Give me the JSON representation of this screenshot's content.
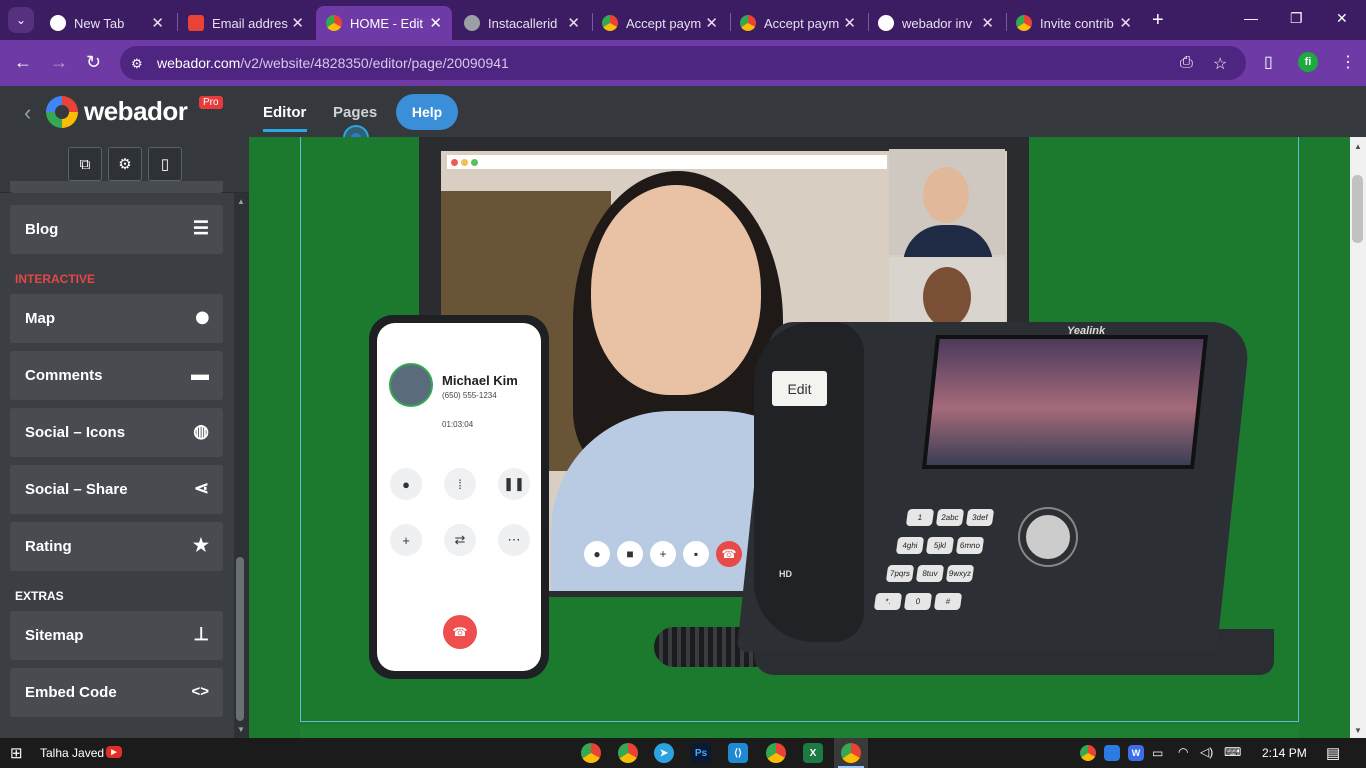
{
  "browser": {
    "tabs": [
      {
        "label": "New Tab",
        "favicon_color": "#ffffff"
      },
      {
        "label": "Email addres",
        "favicon_color": "#ea4335"
      },
      {
        "label": "HOME - Edit",
        "favicon_color": "#fbbc05",
        "active": true
      },
      {
        "label": "Instacallerid",
        "favicon_color": "#9aa0a6"
      },
      {
        "label": "Accept paym",
        "favicon_color": "#fbbc05"
      },
      {
        "label": "Accept paym",
        "favicon_color": "#fbbc05"
      },
      {
        "label": "webador inv",
        "favicon_color": "#ffffff"
      },
      {
        "label": "Invite contrib",
        "favicon_color": "#fbbc05"
      }
    ],
    "tab_close": "✕",
    "new_tab": "+",
    "url_host": "webador.com",
    "url_path": "/v2/website/4828350/editor/page/20090941",
    "extension_label": "fi"
  },
  "editor": {
    "logo_text": "webador",
    "pro_badge": "Pro",
    "tabs": {
      "editor": "Editor",
      "pages": "Pages"
    },
    "help_label": "Help"
  },
  "sidebar": {
    "items_top": [
      {
        "label": "Blog",
        "icon": "document-icon",
        "glyph": "☰"
      }
    ],
    "section_interactive": "INTERACTIVE",
    "interactive_items": [
      {
        "label": "Map",
        "icon": "map-pin-icon",
        "glyph": "⬤"
      },
      {
        "label": "Comments",
        "icon": "comment-icon",
        "glyph": "▬"
      },
      {
        "label": "Social – Icons",
        "icon": "globe-icon",
        "glyph": "◍"
      },
      {
        "label": "Social – Share",
        "icon": "share-icon",
        "glyph": "⋖"
      },
      {
        "label": "Rating",
        "icon": "star-icon",
        "glyph": "★"
      }
    ],
    "section_extras": "EXTRAS",
    "extras_items": [
      {
        "label": "Sitemap",
        "icon": "sitemap-icon",
        "glyph": "⊥"
      },
      {
        "label": "Embed Code",
        "icon": "code-icon",
        "glyph": "<>"
      }
    ],
    "section_color_interactive": "#e84545",
    "section_color_extras": "#ffffff"
  },
  "canvas": {
    "tooltip": "Edit",
    "caller_name": "Michael Kim",
    "caller_number": "(650) 555-1234",
    "call_time": "01:03:04",
    "desk_brand": "Yealink",
    "desk_hd": "HD",
    "keypad": [
      "1",
      "2abc",
      "3def",
      "4ghi",
      "5jkl",
      "6mno",
      "7pqrs",
      "8tuv",
      "9wxyz",
      "*.",
      "0",
      "#"
    ]
  },
  "taskbar": {
    "user": "Talha Javed",
    "time": "2:14 PM"
  }
}
